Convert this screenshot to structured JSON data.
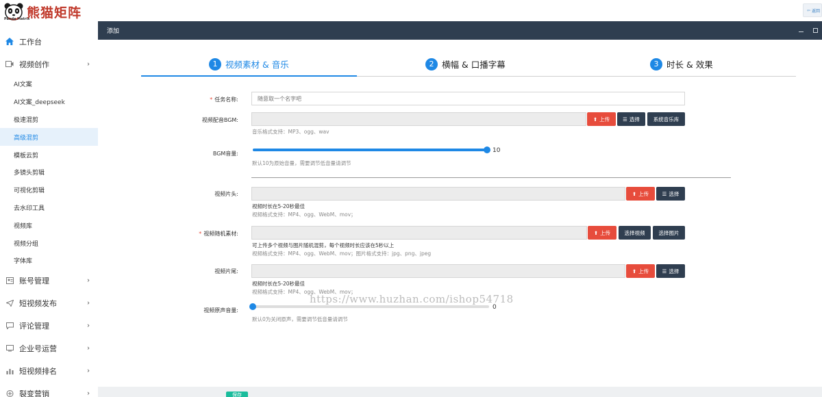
{
  "app": {
    "logo_text": "熊猫矩阵",
    "logo_sub": "Panda Matrix"
  },
  "topbar": {
    "back_label": "返回"
  },
  "sidebar": {
    "items": [
      {
        "label": "工作台",
        "icon": "home-icon",
        "chevron": false
      },
      {
        "label": "视频创作",
        "icon": "video-icon",
        "chevron": true
      },
      {
        "label": "账号管理",
        "icon": "account-icon",
        "chevron": true
      },
      {
        "label": "短视频发布",
        "icon": "send-icon",
        "chevron": true
      },
      {
        "label": "评论管理",
        "icon": "comment-icon",
        "chevron": true
      },
      {
        "label": "企业号运营",
        "icon": "enterprise-icon",
        "chevron": true
      },
      {
        "label": "短视频排名",
        "icon": "chart-icon",
        "chevron": true
      },
      {
        "label": "裂变营销",
        "icon": "fission-icon",
        "chevron": true
      }
    ],
    "sub_items": [
      {
        "label": "AI文案",
        "active": false
      },
      {
        "label": "AI文案_deepseek",
        "active": false
      },
      {
        "label": "极速混剪",
        "active": false
      },
      {
        "label": "高级混剪",
        "active": true
      },
      {
        "label": "模板云剪",
        "active": false
      },
      {
        "label": "多镜头剪辑",
        "active": false
      },
      {
        "label": "可视化剪辑",
        "active": false
      },
      {
        "label": "去水印工具",
        "active": false
      },
      {
        "label": "视频库",
        "active": false
      },
      {
        "label": "视频分组",
        "active": false
      },
      {
        "label": "字体库",
        "active": false
      }
    ]
  },
  "header": {
    "title": "添加"
  },
  "steps": [
    {
      "num": "1",
      "label": "视频素材 & 音乐",
      "active": true
    },
    {
      "num": "2",
      "label": "横幅 & 口播字幕",
      "active": false
    },
    {
      "num": "3",
      "label": "时长 & 效果",
      "active": false
    }
  ],
  "form": {
    "task_name": {
      "label": "任务名称:",
      "required": true,
      "placeholder": "随意取一个名字吧"
    },
    "bgm": {
      "label": "视频配音BGM:",
      "upload": "上传",
      "select": "选择",
      "library": "系统音乐库",
      "help": "音乐格式支持：MP3、ogg、wav"
    },
    "bgm_volume": {
      "label": "BGM音量:",
      "value": "10",
      "fraction": 1.0,
      "help": "默认10为原始音量，需要调节低音量请调节"
    },
    "intro": {
      "label": "视频片头:",
      "upload": "上传",
      "select": "选择",
      "help1": "视频时长在5-20秒最佳",
      "help2": "视频格式支持：MP4、ogg、WebM、mov；"
    },
    "random_material": {
      "label": "视频随机素材:",
      "required": true,
      "upload": "上传",
      "select_video": "选择视频",
      "select_image": "选择图片",
      "help1": "可上传多个视频与图片随机混剪，每个视频时长应该在5秒以上",
      "help2": "视频格式支持：MP4、ogg、WebM、mov；图片格式支持：jpg、png、jpeg"
    },
    "outro": {
      "label": "视频片尾:",
      "upload": "上传",
      "select": "选择",
      "help1": "视频时长在5-20秒最佳",
      "help2": "视频格式支持：MP4、ogg、WebM、mov；"
    },
    "original_volume": {
      "label": "视频原声音量:",
      "value": "0",
      "fraction": 0.0,
      "help": "默认0为关闭原声，需要调节低音量请调节"
    }
  },
  "watermark": "https://www.huzhan.com/ishop54718",
  "footer": {
    "save_label": "保存"
  },
  "colors": {
    "accent": "#1e88e5",
    "danger": "#e74c3c",
    "dark": "#2f3e50",
    "success": "#1abc9c"
  }
}
